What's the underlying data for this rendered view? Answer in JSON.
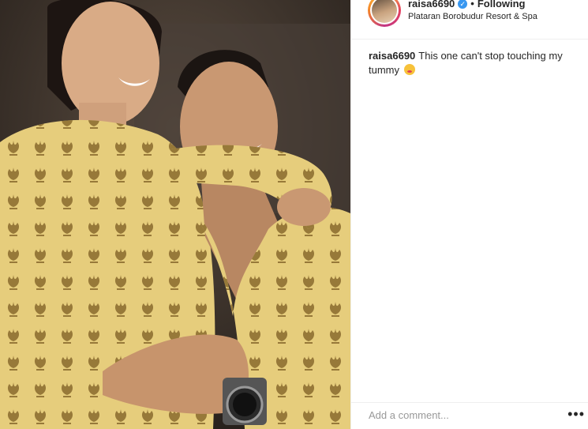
{
  "post": {
    "username": "raisa6690",
    "follow_status": "Following",
    "separator": "•",
    "location": "Plataran Borobudur Resort & Spa",
    "verified_badge": "check-icon"
  },
  "caption": {
    "username": "raisa6690",
    "text": "This one can't stop touching my tummy",
    "emoji": "kissing-face-icon"
  },
  "comment": {
    "placeholder": "Add a comment...",
    "more_label": "•••"
  },
  "colors": {
    "verified": "#3897f0",
    "robe": "#e6cd7c",
    "pattern": "#8a6a2e"
  }
}
